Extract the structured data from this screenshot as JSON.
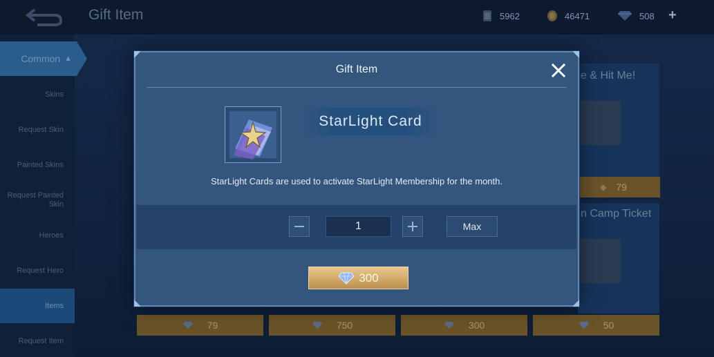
{
  "header": {
    "title": "Gift Item",
    "resources": [
      {
        "icon": "ticket-card-icon",
        "value": "5962"
      },
      {
        "icon": "coin-icon",
        "value": "46471"
      },
      {
        "icon": "diamond-icon",
        "value": "508"
      }
    ],
    "plus_label": "+"
  },
  "sidebar": {
    "category": "Common",
    "items": [
      {
        "label": "Skins"
      },
      {
        "label": "Request Skin"
      },
      {
        "label": "Painted Skins"
      },
      {
        "label": "Request Painted Skin"
      },
      {
        "label": "Heroes"
      },
      {
        "label": "Request Hero"
      },
      {
        "label": "Items"
      },
      {
        "label": "Request Item"
      }
    ]
  },
  "background_cards": {
    "right_top_title": "e & Hit Me!",
    "right_top_price": "79",
    "right_mid_title": "n Camp Ticket",
    "bottom_prices": [
      "79",
      "750",
      "300",
      "50"
    ]
  },
  "modal": {
    "title": "Gift Item",
    "item_name": "StarLight Card",
    "item_description": "StarLight Cards are used to activate StarLight Membership for the month.",
    "quantity": "1",
    "max_label": "Max",
    "price": "300",
    "colors": {
      "panel": "#33557e",
      "buy_button": "#d3aa69",
      "diamond": "#8fb6ff"
    }
  }
}
